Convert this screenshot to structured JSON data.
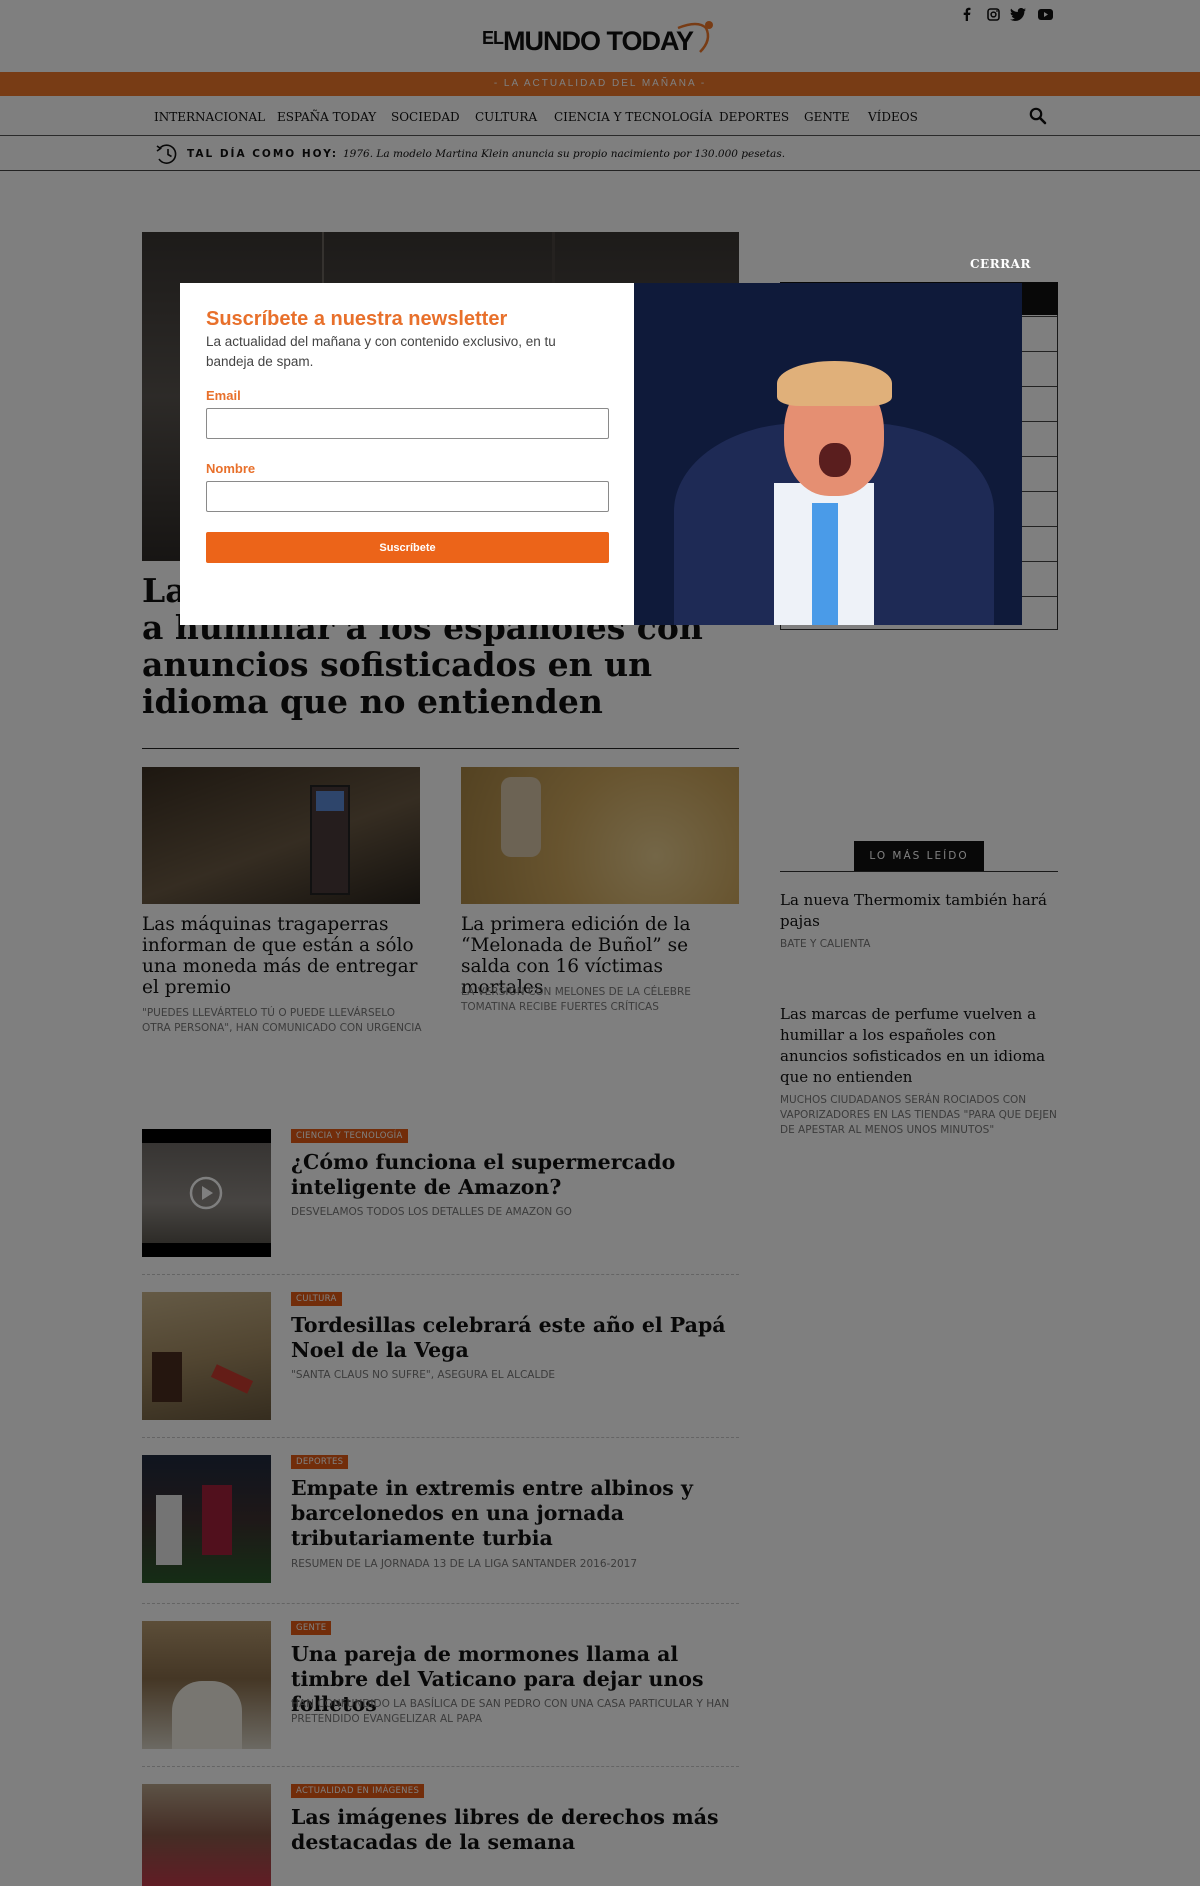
{
  "header": {
    "logo_el": "EL",
    "logo_main": "MUNDO TODAY",
    "tagline": "- LA ACTUALIDAD DEL MAÑANA -",
    "social": [
      "facebook-icon",
      "instagram-icon",
      "twitter-icon",
      "youtube-icon"
    ]
  },
  "nav": {
    "items": [
      "INTERNACIONAL",
      "ESPAÑA TODAY",
      "SOCIEDAD",
      "CULTURA",
      "CIENCIA Y TECNOLOGÍA",
      "DEPORTES",
      "GENTE",
      "VÍDEOS"
    ]
  },
  "ticker": {
    "label": "TAL DÍA COMO HOY:",
    "text": "1976. La modelo Martina Klein anuncia su propio nacimiento por 130.000 pesetas."
  },
  "main": {
    "headline": "Las marcas de perfume vuelven a humillar a los españoles con anuncios sofisticados en un idioma que no entienden",
    "cards": [
      {
        "title": "Las máquinas tragaperras informan de que están a sólo una moneda más de entregar el premio",
        "subtitle": "\"PUEDES LLEVÁRTELO TÚ O PUEDE LLEVÁRSELO OTRA PERSONA\", HAN COMUNICADO CON URGENCIA"
      },
      {
        "title": "La primera edición de la “Melonada de Buñol” se salda con 16 víctimas mortales",
        "subtitle": "LA VERSIÓN CON MELONES DE LA CÉLEBRE TOMATINA RECIBE FUERTES CRÍTICAS"
      }
    ],
    "list": [
      {
        "tag": "CIENCIA Y TECNOLOGÍA",
        "title": "¿Cómo funciona el supermercado inteligente de Amazon?",
        "subtitle": "DESVELAMOS TODOS LOS DETALLES DE AMAZON GO"
      },
      {
        "tag": "CULTURA",
        "title": "Tordesillas celebrará este año el Papá Noel de la Vega",
        "subtitle": "\"SANTA CLAUS NO SUFRE\", ASEGURA EL ALCALDE"
      },
      {
        "tag": "DEPORTES",
        "title": "Empate in extremis entre albinos y barcelonedos en una jornada tributariamente turbia",
        "subtitle": "RESUMEN DE LA JORNADA 13 DE LA LIGA SANTANDER 2016-2017"
      },
      {
        "tag": "GENTE",
        "title": "Una pareja de mormones llama al timbre del Vaticano para dejar unos folletos",
        "subtitle": "HAN CONFUNDIDO LA BASÍLICA DE SAN PEDRO CON UNA CASA PARTICULAR Y HAN PRETENDIDO EVANGELIZAR AL PAPA"
      },
      {
        "tag": "ACTUALIDAD EN IMÁGENES",
        "title": "Las imágenes libres de derechos más destacadas de la semana",
        "subtitle": ""
      }
    ]
  },
  "sidebar": {
    "section_title": "LO MÁS LEÍDO",
    "items": [
      {
        "title": "La nueva Thermomix también hará pajas",
        "subtitle": "BATE Y CALIENTA"
      },
      {
        "title": "Las marcas de perfume vuelven a humillar a los españoles con anuncios sofisticados en un idioma que no entienden",
        "subtitle": "MUCHOS CIUDADANOS SERÁN ROCIADOS CON VAPORIZADORES EN LAS TIENDAS \"PARA QUE DEJEN DE APESTAR AL MENOS UNOS MINUTOS\""
      }
    ]
  },
  "modal": {
    "close_label": "CERRAR",
    "title": "Suscríbete a nuestra newsletter",
    "description": "La actualidad del mañana y con contenido exclusivo, en tu bandeja de spam.",
    "email_label": "Email",
    "email_value": "",
    "name_label": "Nombre",
    "name_value": "",
    "submit_label": "Suscríbete"
  },
  "colors": {
    "brand_orange": "#f0782a",
    "tag_orange": "#e45b14",
    "button_orange": "#ec6419"
  }
}
